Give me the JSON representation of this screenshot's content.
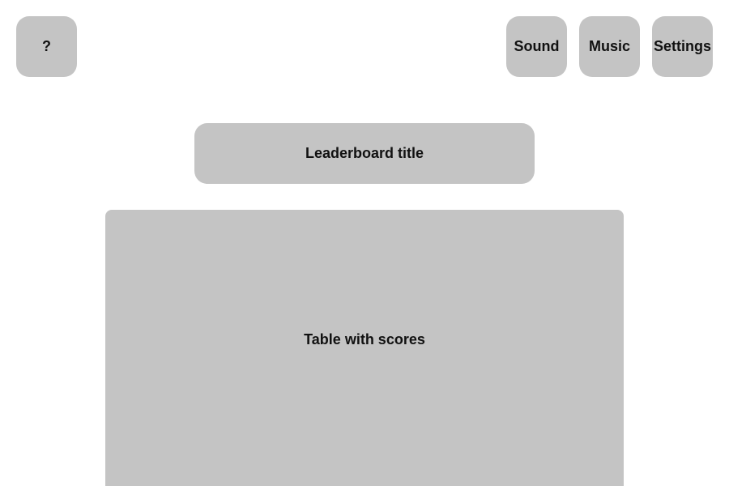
{
  "header": {
    "help_label": "?",
    "sound_label": "Sound",
    "music_label": "Music",
    "settings_label": "Settings"
  },
  "main": {
    "title": "Leaderboard title",
    "table_placeholder": "Table with scores"
  },
  "colors": {
    "background": "#ffffff",
    "tile": "#c4c4c4",
    "text": "#111111"
  }
}
